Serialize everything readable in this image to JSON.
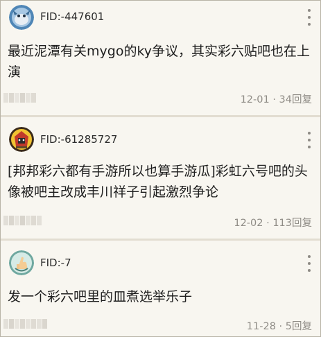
{
  "colors": {
    "background": "#f8f6f0",
    "divider": "#e2ddd1",
    "meta_text": "#8f8c86",
    "avatar_1": "#4f86b6",
    "avatar_2": "#f1c232",
    "avatar_3": "#6fa8a0"
  },
  "icons": {
    "more": "vertical-ellipsis-icon"
  },
  "posts": [
    {
      "fid": "FID:-447601",
      "title": "最近泥潭有关mygo的ky争议，其实彩六贴吧也在上演",
      "date": "12-01",
      "replies": "34回复"
    },
    {
      "fid": "FID:-61285727",
      "title": "[邦邦彩六都有手游所以也算手游瓜]彩虹六号吧的头像被吧主改成丰川祥子引起激烈争论",
      "date": "12-02",
      "replies": "113回复"
    },
    {
      "fid": "FID:-7",
      "title": "发一个彩六吧里的皿煮选举乐子",
      "date": "11-28",
      "replies": "5回复"
    }
  ],
  "meta_separator": "·"
}
